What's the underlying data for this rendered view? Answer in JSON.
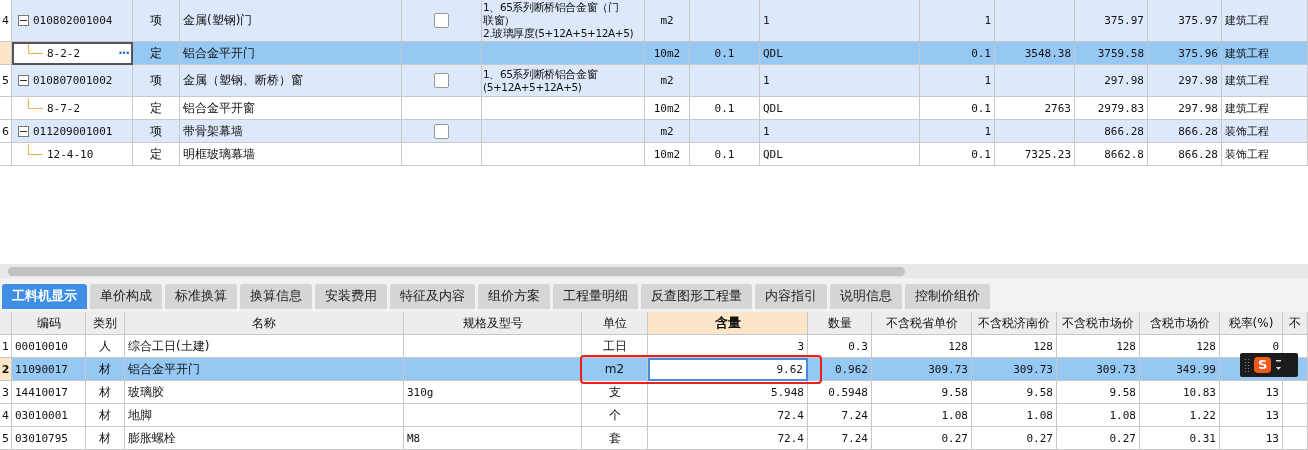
{
  "top_grid": {
    "rows": [
      {
        "kind": "bill",
        "selected": false,
        "row_number": "4",
        "code": "010802001004",
        "category": "项",
        "name": "金属(塑钢)门",
        "checked": false,
        "feature": [
          "1、65系列断桥铝合金窗（门",
          "联窗）",
          "2.玻璃厚度(5+12A+5+12A+5)"
        ],
        "values": {
          "column_7": "m2",
          "column_9": "1",
          "column_10": "1",
          "column_12": "375.97",
          "column_13": "375.97",
          "column_14": "建筑工程"
        }
      },
      {
        "kind": "quota",
        "selected": true,
        "code": "8-2-2",
        "more_button": "···",
        "category": "定",
        "name": "铝合金平开门",
        "feature": [],
        "values": {
          "column_7": "10m2",
          "column_8": "0.1",
          "column_9": "QDL",
          "column_10": "0.1",
          "column_11": "3548.38",
          "column_12": "3759.58",
          "column_13": "375.96",
          "column_14": "建筑工程"
        }
      },
      {
        "kind": "bill",
        "selected": false,
        "row_number": "5",
        "code": "010807001002",
        "category": "项",
        "name": "金属（塑钢、断桥）窗",
        "checked": false,
        "feature": [
          "1、65系列断桥铝合金窗",
          "(5+12A+5+12A+5)"
        ],
        "values": {
          "column_7": "m2",
          "column_9": "1",
          "column_10": "1",
          "column_12": "297.98",
          "column_13": "297.98",
          "column_14": "建筑工程"
        }
      },
      {
        "kind": "quota",
        "selected": false,
        "code": "8-7-2",
        "category": "定",
        "name": "铝合金平开窗",
        "feature": [],
        "values": {
          "column_7": "10m2",
          "column_8": "0.1",
          "column_9": "QDL",
          "column_10": "0.1",
          "column_11": "2763",
          "column_12": "2979.83",
          "column_13": "297.98",
          "column_14": "建筑工程"
        }
      },
      {
        "kind": "bill",
        "selected": false,
        "row_number": "6",
        "code": "011209001001",
        "category": "项",
        "name": "带骨架幕墙",
        "checked": false,
        "feature": [],
        "values": {
          "column_7": "m2",
          "column_9": "1",
          "column_10": "1",
          "column_12": "866.28",
          "column_13": "866.28",
          "column_14": "装饰工程"
        }
      },
      {
        "kind": "quota",
        "selected": false,
        "code": "12-4-10",
        "category": "定",
        "name": "明框玻璃幕墙",
        "feature": [],
        "values": {
          "column_7": "10m2",
          "column_8": "0.1",
          "column_9": "QDL",
          "column_10": "0.1",
          "column_11": "7325.23",
          "column_12": "8662.8",
          "column_13": "866.28",
          "column_14": "装饰工程"
        }
      }
    ]
  },
  "tabs": [
    {
      "label": "工料机显示",
      "selected": true
    },
    {
      "label": "单价构成",
      "selected": false
    },
    {
      "label": "标准换算",
      "selected": false
    },
    {
      "label": "换算信息",
      "selected": false
    },
    {
      "label": "安装费用",
      "selected": false
    },
    {
      "label": "特征及内容",
      "selected": false
    },
    {
      "label": "组价方案",
      "selected": false
    },
    {
      "label": "工程量明细",
      "selected": false
    },
    {
      "label": "反查图形工程量",
      "selected": false
    },
    {
      "label": "内容指引",
      "selected": false
    },
    {
      "label": "说明信息",
      "selected": false
    },
    {
      "label": "控制价组价",
      "selected": false
    }
  ],
  "resource_grid": {
    "columns": [
      {
        "label": "编码",
        "sorted": false
      },
      {
        "label": "类别",
        "sorted": false
      },
      {
        "label": "名称",
        "sorted": false
      },
      {
        "label": "规格及型号",
        "sorted": false
      },
      {
        "label": "单位",
        "sorted": false
      },
      {
        "label": "含量",
        "sorted": true
      },
      {
        "label": "数量",
        "sorted": false
      },
      {
        "label": "不含税省单价",
        "sorted": false
      },
      {
        "label": "不含税济南价",
        "sorted": false
      },
      {
        "label": "不含税市场价",
        "sorted": false
      },
      {
        "label": "含税市场价",
        "sorted": false
      },
      {
        "label": "税率(%)",
        "sorted": false
      },
      {
        "label": "不",
        "sorted": false
      }
    ],
    "rows": [
      {
        "row_number": "1",
        "selected": false,
        "editing": false,
        "cells": [
          "00010010",
          "人",
          "综合工日(土建)",
          null,
          "工日",
          "3",
          "0.3",
          "128",
          "128",
          "128",
          "128",
          "0",
          null
        ]
      },
      {
        "row_number": "2",
        "selected": true,
        "editing": true,
        "cells": [
          "11090017",
          "材",
          "铝合金平开门",
          null,
          "m2",
          "9.62",
          "0.962",
          "309.73",
          "309.73",
          "309.73",
          "349.99",
          null,
          null
        ]
      },
      {
        "row_number": "3",
        "selected": false,
        "editing": false,
        "cells": [
          "14410017",
          "材",
          "玻璃胶",
          "310g",
          "支",
          "5.948",
          "0.5948",
          "9.58",
          "9.58",
          "9.58",
          "10.83",
          "13",
          null
        ]
      },
      {
        "row_number": "4",
        "selected": false,
        "editing": false,
        "cells": [
          "03010001",
          "材",
          "地脚",
          null,
          "个",
          "72.4",
          "7.24",
          "1.08",
          "1.08",
          "1.08",
          "1.22",
          "13",
          null
        ]
      },
      {
        "row_number": "5",
        "selected": false,
        "editing": false,
        "cells": [
          "03010795",
          "材",
          "膨胀螺栓",
          "M8",
          "套",
          "72.4",
          "7.24",
          "0.27",
          "0.27",
          "0.27",
          "0.31",
          "13",
          null
        ]
      }
    ]
  },
  "ime_badge": "S"
}
